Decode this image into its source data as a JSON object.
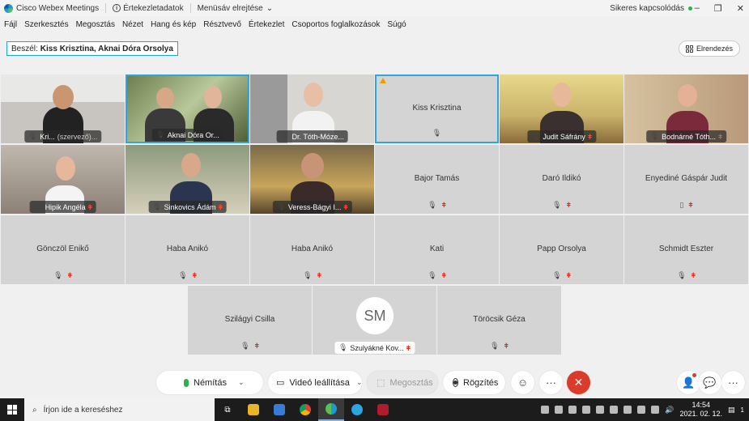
{
  "window": {
    "app_title": "Cisco Webex Meetings",
    "meeting_info": "Értekezletadatok",
    "hide_menu": "Menüsáv elrejtése",
    "status": "Sikeres kapcsolódás",
    "btn_min": "–",
    "btn_max": "❐",
    "btn_close": "✕"
  },
  "menu": [
    "Fájl",
    "Szerkesztés",
    "Megosztás",
    "Nézet",
    "Hang és kép",
    "Résztvevő",
    "Értekezlet",
    "Csoportos foglalkozások",
    "Súgó"
  ],
  "speaker": {
    "prefix": "Beszél:",
    "names": "Kiss Krisztina, Aknai Dóra Orsolya"
  },
  "layout_button": "Elrendezés",
  "video_tiles": [
    {
      "name": "Kri...",
      "sub": "(szervező)...",
      "muted": false
    },
    {
      "name": "Aknai Dóra Or...",
      "muted": false
    },
    {
      "name": "Dr. Tóth-Móze...",
      "muted": false
    },
    {
      "name": "Kiss Krisztina",
      "muted": false
    },
    {
      "name": "Judit Sáfrány",
      "muted": true
    },
    {
      "name": "Bodnárné Tóth...",
      "muted": true
    },
    {
      "name": "Hipik Angéla",
      "muted": true
    },
    {
      "name": "Sinkovics Ádám",
      "muted": true
    },
    {
      "name": "Veress-Bágyi I...",
      "muted": true
    }
  ],
  "name_tiles": [
    "Bajor Tamás",
    "Daró Ildikó",
    "Enyediné Gáspár Judit",
    "Gönczöl Enikő",
    "Haba Anikó",
    "Haba Anikó",
    "Kati",
    "Papp Orsolya",
    "Schmidt Eszter",
    "Szilágyi Csilla",
    "Szulyákné Kov...",
    "Töröcsik Géza"
  ],
  "avatar_initials": "SM",
  "controls": {
    "mute": "Némítás",
    "video": "Videó leállítása",
    "share": "Megosztás",
    "record": "Rögzítés",
    "more": "···",
    "end": "✕"
  },
  "taskbar": {
    "search_placeholder": "Írjon ide a kereséshez",
    "time": "14:54",
    "date": "2021. 02. 12.",
    "notification_count": "1"
  },
  "colors": {
    "accent": "#2ea6dc",
    "end_call": "#da3b2a",
    "mic_active": "#2eae4f",
    "muted": "#d72a1b"
  }
}
